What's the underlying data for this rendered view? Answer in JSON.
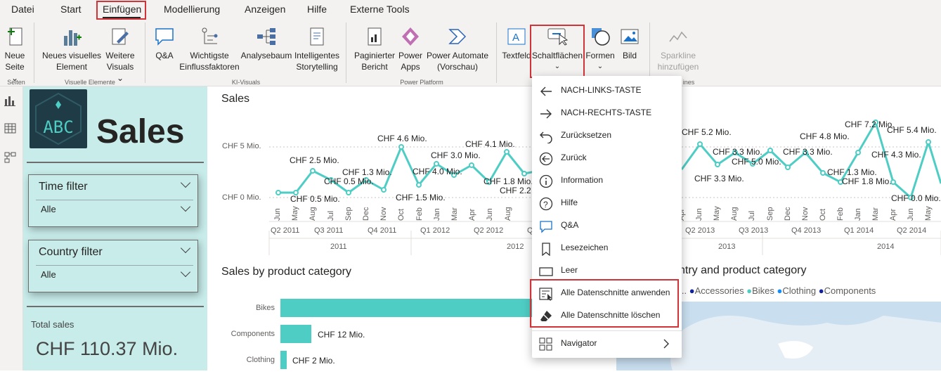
{
  "menubar": {
    "items": [
      "Datei",
      "Start",
      "Einfügen",
      "Modellierung",
      "Anzeigen",
      "Hilfe",
      "Externe Tools"
    ],
    "active": "Einfügen"
  },
  "ribbon": {
    "neue_seite": [
      "Neue",
      "Seite ⌄"
    ],
    "neues_visuelles": [
      "Neues visuelles",
      "Element"
    ],
    "weitere_visuals": [
      "Weitere",
      "Visuals ⌄"
    ],
    "qa": "Q&A",
    "wichtigste": [
      "Wichtigste",
      "Einflussfaktoren"
    ],
    "analysebaum": "Analysebaum",
    "intelligentes": [
      "Intelligentes",
      "Storytelling"
    ],
    "paginierter": [
      "Paginierter",
      "Bericht"
    ],
    "power_apps": [
      "Power",
      "Apps"
    ],
    "power_automate": [
      "Power Automate",
      "(Vorschau)"
    ],
    "textfeld": "Textfeld",
    "schaltflaechen": "Schaltflächen",
    "formen": "Formen",
    "bild": "Bild",
    "sparkline": [
      "Sparkline",
      "hinzufügen"
    ],
    "groups": {
      "seiten": "Seiten",
      "visuelle": "Visuelle Elemente",
      "ki": "KI-Visuals",
      "power": "Power Platform",
      "lines": "ines"
    }
  },
  "left_panel": {
    "logo_text": "ABC",
    "title": "Sales",
    "time_filter": {
      "label": "Time filter",
      "value": "Alle"
    },
    "country_filter": {
      "label": "Country filter",
      "value": "Alle"
    },
    "total_sales_label": "Total sales",
    "total_sales_value": "CHF 110.37 Mio."
  },
  "colors": {
    "teal": "#4ecdc4",
    "panel": "#c7ecea",
    "highlight_red": "#d13438",
    "legend_dot": "#12239e"
  },
  "sales_chart": {
    "title": "Sales",
    "y_labels": [
      "CHF 5 Mio.",
      "CHF 0 Mio."
    ],
    "data_labels_left": [
      "CHF 4.6 Mio.",
      "CHF 4.1 Mio.",
      "CHF 2.5 Mio.",
      "CHF 3.0 Mio.",
      "CHF 1.3 Mio.",
      "CHF 0.5 Mio.",
      "CHF 4.0 Mio.",
      "CHF 1.8 Mio.",
      "CHF 2.2",
      "CHF 0.5 Mio.",
      "CHF 1.5 Mio."
    ],
    "data_labels_right": [
      "CHF 5.2 Mio.",
      "CHF 3.3 Mio.",
      "CHF 5.0 Mio.",
      "CHF 3.3 Mio.",
      "CHF 4.8 Mio.",
      "CHF 7.2 Mio.",
      "CHF 5.4 Mio.",
      "CHF 4.3 Mio.",
      "CHF 1.3 Mio.",
      "CHF 1.8 Mio.",
      "CHF 0.0 Mio.",
      "CHF 0.0 Mio.",
      "CHF 3.3 Mio."
    ],
    "months_left": [
      "Jun",
      "May",
      "Aug",
      "Jul",
      "Sep",
      "Dec",
      "Nov",
      "Oct",
      "Feb",
      "Jan",
      "Mar",
      "Apr",
      "Jun",
      "Aug"
    ],
    "months_right": [
      "Apr",
      "Jun",
      "May",
      "Aug",
      "Jul",
      "Sep",
      "Dec",
      "Nov",
      "Oct",
      "Feb",
      "Jan",
      "Mar",
      "Apr",
      "Jun",
      "May"
    ],
    "quarters_left": [
      "Q2 2011",
      "Q3 2011",
      "Q4 2011",
      "Q1 2012",
      "Q2 2012",
      "Q"
    ],
    "quarters_right": [
      "Q2 2013",
      "Q3 2013",
      "Q4 2013",
      "Q1 2014",
      "Q2 2014"
    ],
    "years": [
      "2011",
      "2012",
      "2013",
      "2014"
    ]
  },
  "bar_chart": {
    "title": "Sales by product category",
    "rows": [
      {
        "label": "Bikes",
        "value_label": ""
      },
      {
        "label": "Components",
        "value_label": "CHF 12 Mio."
      },
      {
        "label": "Clothing",
        "value_label": "CHF 2 Mio."
      }
    ]
  },
  "map_chart": {
    "title": "ntry and product category",
    "legend_prefix": "o...",
    "legend": [
      "Accessories",
      "Bikes",
      "Clothing",
      "Components"
    ],
    "legend_colors": [
      "#12239e",
      "#4ecdc4",
      "#118dff",
      "#12239e"
    ]
  },
  "dropdown": {
    "items": [
      {
        "icon": "arrow-left-icon",
        "label": "NACH-LINKS-TASTE"
      },
      {
        "icon": "arrow-right-icon",
        "label": "NACH-RECHTS-TASTE"
      },
      {
        "icon": "reset-icon",
        "label": "Zurücksetzen"
      },
      {
        "icon": "back-circle-icon",
        "label": "Zurück"
      },
      {
        "icon": "info-icon",
        "label": "Information"
      },
      {
        "icon": "help-icon",
        "label": "Hilfe"
      },
      {
        "icon": "qa-icon",
        "label": "Q&A"
      },
      {
        "icon": "bookmark-icon",
        "label": "Lesezeichen"
      },
      {
        "icon": "blank-icon",
        "label": "Leer"
      },
      {
        "icon": "apply-slicers-icon",
        "label": "Alle Datenschnitte anwenden"
      },
      {
        "icon": "eraser-icon",
        "label": "Alle Datenschnitte löschen"
      },
      {
        "icon": "navigator-icon",
        "label": "Navigator"
      }
    ]
  }
}
